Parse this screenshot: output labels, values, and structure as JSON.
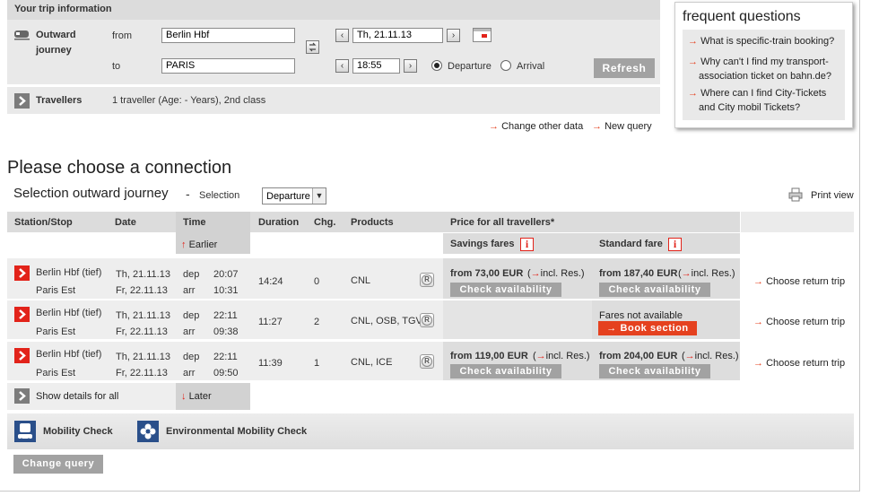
{
  "trip": {
    "header": "Your trip information",
    "outward_label_1": "Outward",
    "outward_label_2": "journey",
    "from_label": "from",
    "to_label": "to",
    "from_value": "Berlin Hbf",
    "to_value": "PARIS",
    "date_value": "Th, 21.11.13",
    "time_value": "18:55",
    "departure_label": "Departure",
    "arrival_label": "Arrival",
    "refresh_label": "Refresh",
    "travellers_label": "Travellers",
    "travellers_value": "1 traveller (Age: - Years), 2nd class",
    "change_other": "Change other data",
    "new_query": "New query"
  },
  "faq": {
    "title": "frequent questions",
    "items": [
      "What is specific-train booking?",
      "Why can't I find my transport-",
      "association ticket on bahn.de?",
      "Where can I find City-Tickets",
      "and City mobil Tickets?"
    ]
  },
  "main": {
    "heading": "Please choose a connection",
    "subheading": "Selection outward journey",
    "dash": "-",
    "selection_label": "Selection",
    "selection_value": "Departure",
    "print_view": "Print view"
  },
  "table": {
    "headers": {
      "station": "Station/Stop",
      "date": "Date",
      "time": "Time",
      "duration": "Duration",
      "chg": "Chg.",
      "products": "Products",
      "price": "Price for all travellers*",
      "savings": "Savings fares",
      "standard": "Standard fare"
    },
    "earlier": "Earlier",
    "later": "Later",
    "dep": "dep",
    "arr": "arr",
    "choose_return": "Choose return trip",
    "check_availability": "Check availability",
    "incl_res": "incl. Res.)",
    "rows": [
      {
        "from": "Berlin Hbf (tief)",
        "to": "Paris Est",
        "date_dep": "Th, 21.11.13",
        "date_arr": "Fr, 22.11.13",
        "time_dep": "20:07",
        "time_arr": "10:31",
        "duration": "14:24",
        "changes": "0",
        "products": "CNL",
        "savings_price": "from 73,00 EUR",
        "standard_price": "from 187,40 EUR"
      },
      {
        "from": "Berlin Hbf (tief)",
        "to": "Paris Est",
        "date_dep": "Th, 21.11.13",
        "date_arr": "Fr, 22.11.13",
        "time_dep": "22:11",
        "time_arr": "09:38",
        "duration": "11:27",
        "changes": "2",
        "products": "CNL, OSB, TGV",
        "fares_not_available": "Fares not available",
        "book_section": "Book section"
      },
      {
        "from": "Berlin Hbf (tief)",
        "to": "Paris Est",
        "date_dep": "Th, 21.11.13",
        "date_arr": "Fr, 22.11.13",
        "time_dep": "22:11",
        "time_arr": "09:50",
        "duration": "11:39",
        "changes": "1",
        "products": "CNL, ICE",
        "savings_price": "from 119,00 EUR",
        "standard_price": "from 204,00 EUR"
      }
    ],
    "show_details": "Show details for all"
  },
  "footer": {
    "mobility_check": "Mobility Check",
    "env_mobility_check": "Environmental Mobility Check",
    "change_query": "Change query"
  },
  "colors": {
    "accent": "#e2231a",
    "button_grey": "#a2a2a2",
    "book_orange": "#e5411f"
  }
}
